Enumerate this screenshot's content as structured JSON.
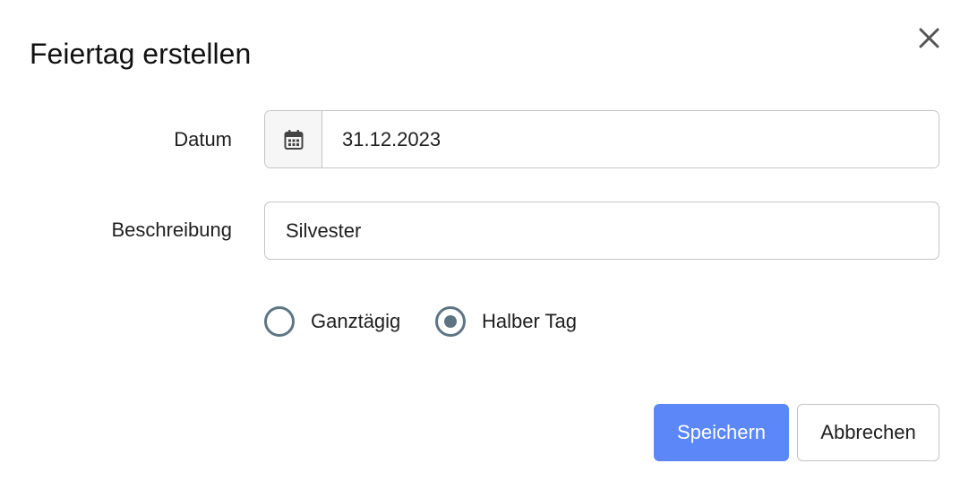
{
  "dialog": {
    "title": "Feiertag erstellen",
    "close_icon": "close-icon"
  },
  "form": {
    "date_label": "Datum",
    "date_value": "31.12.2023",
    "calendar_icon": "calendar-icon",
    "description_label": "Beschreibung",
    "description_value": "Silvester",
    "radio_options": [
      {
        "label": "Ganztägig",
        "selected": false
      },
      {
        "label": "Halber Tag",
        "selected": true
      }
    ]
  },
  "actions": {
    "save_label": "Speichern",
    "cancel_label": "Abbrechen"
  },
  "colors": {
    "primary": "#5b87f9",
    "radio": "#5d7583",
    "border": "#c4c4c4"
  }
}
